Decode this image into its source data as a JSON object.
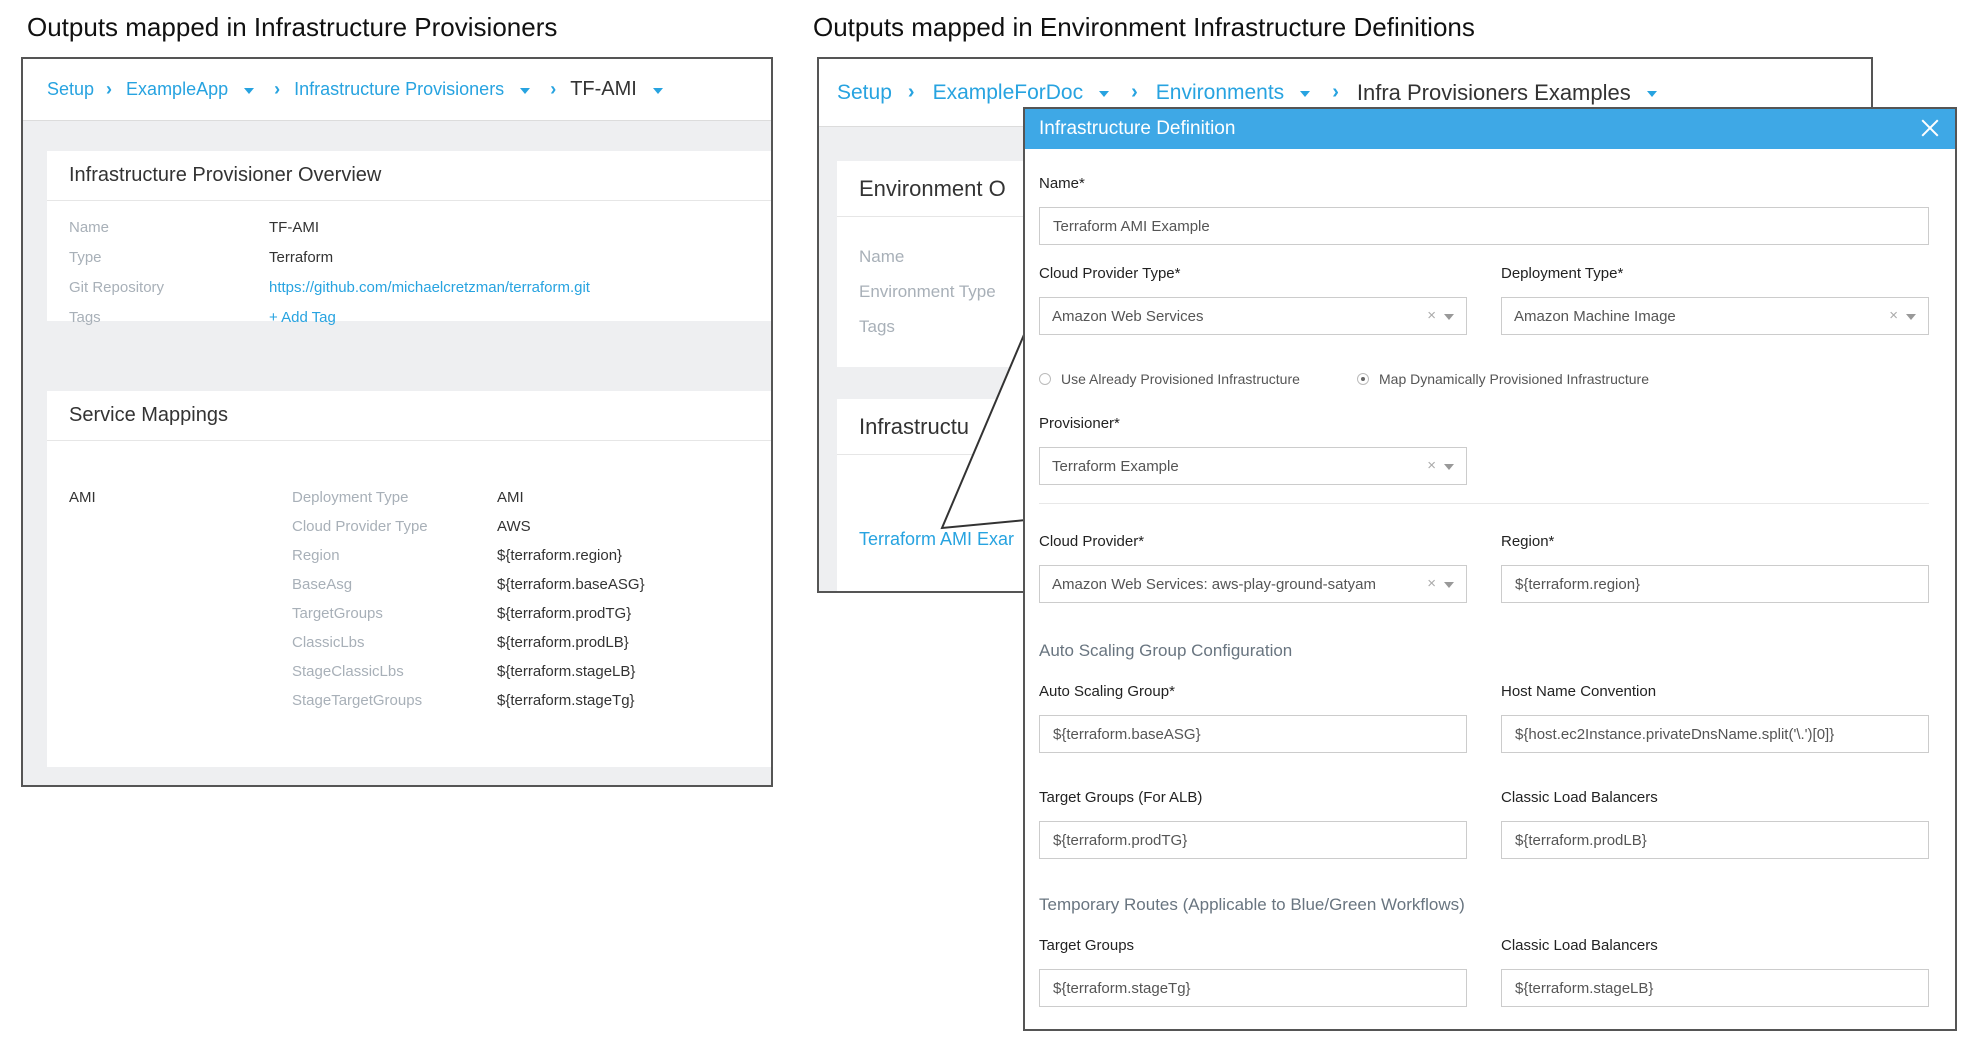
{
  "headings": {
    "left": "Outputs mapped in Infrastructure Provisioners",
    "right": "Outputs mapped in Environment Infrastructure Definitions"
  },
  "left_panel": {
    "breadcrumb": [
      "Setup",
      "ExampleApp",
      "Infrastructure Provisioners",
      "TF-AMI"
    ],
    "overview": {
      "title": "Infrastructure Provisioner Overview",
      "rows": [
        {
          "label": "Name",
          "value": "TF-AMI"
        },
        {
          "label": "Type",
          "value": "Terraform"
        },
        {
          "label": "Git Repository",
          "value": "https://github.com/michaelcretzman/terraform.git"
        },
        {
          "label": "Tags",
          "value": "+ Add Tag"
        }
      ]
    },
    "mappings": {
      "title": "Service Mappings",
      "service": "AMI",
      "rows": [
        {
          "label": "Deployment Type",
          "value": "AMI"
        },
        {
          "label": "Cloud Provider Type",
          "value": "AWS"
        },
        {
          "label": "Region",
          "value": "${terraform.region}"
        },
        {
          "label": "BaseAsg",
          "value": "${terraform.baseASG}"
        },
        {
          "label": "TargetGroups",
          "value": "${terraform.prodTG}"
        },
        {
          "label": "ClassicLbs",
          "value": "${terraform.prodLB}"
        },
        {
          "label": "StageClassicLbs",
          "value": "${terraform.stageLB}"
        },
        {
          "label": "StageTargetGroups",
          "value": "${terraform.stageTg}"
        }
      ]
    }
  },
  "right_panel": {
    "breadcrumb": [
      "Setup",
      "ExampleForDoc",
      "Environments",
      "Infra Provisioners Examples"
    ],
    "env_overview_title": "Environment O",
    "env_rows": [
      "Name",
      "Environment Type",
      "Tags"
    ],
    "infra_title": "Infrastructu",
    "infra_link": "Terraform AMI Exar"
  },
  "modal": {
    "title": "Infrastructure Definition",
    "name_label": "Name*",
    "name_value": "Terraform AMI Example",
    "cloud_provider_type_label": "Cloud Provider Type*",
    "cloud_provider_type_value": "Amazon Web Services",
    "deployment_type_label": "Deployment Type*",
    "deployment_type_value": "Amazon Machine Image",
    "radio_use_existing": "Use Already Provisioned Infrastructure",
    "radio_map_dynamic": "Map Dynamically Provisioned Infrastructure",
    "radio_selected": "map_dynamic",
    "provisioner_label": "Provisioner*",
    "provisioner_value": "Terraform Example",
    "cloud_provider_label": "Cloud Provider*",
    "cloud_provider_value": "Amazon Web Services: aws-play-ground-satyam",
    "region_label": "Region*",
    "region_value": "${terraform.region}",
    "asg_section": "Auto Scaling Group Configuration",
    "asg_label": "Auto Scaling Group*",
    "asg_value": "${terraform.baseASG}",
    "host_label": "Host Name Convention",
    "host_value": "${host.ec2Instance.privateDnsName.split('\\.')[0]}",
    "tg_alb_label": "Target Groups (For ALB)",
    "tg_alb_value": "${terraform.prodTG}",
    "clb_label": "Classic Load Balancers",
    "clb_value": "${terraform.prodLB}",
    "temp_section": "Temporary Routes (Applicable to Blue/Green Workflows)",
    "temp_tg_label": "Target Groups",
    "temp_tg_value": "${terraform.stageTg}",
    "temp_clb_label": "Classic Load Balancers",
    "temp_clb_value": "${terraform.stageLB}"
  },
  "colors": {
    "accent": "#27a3e0",
    "modal_header": "#3ea8e6",
    "label_gray": "#a8b0b8",
    "section_gray": "#697580"
  }
}
